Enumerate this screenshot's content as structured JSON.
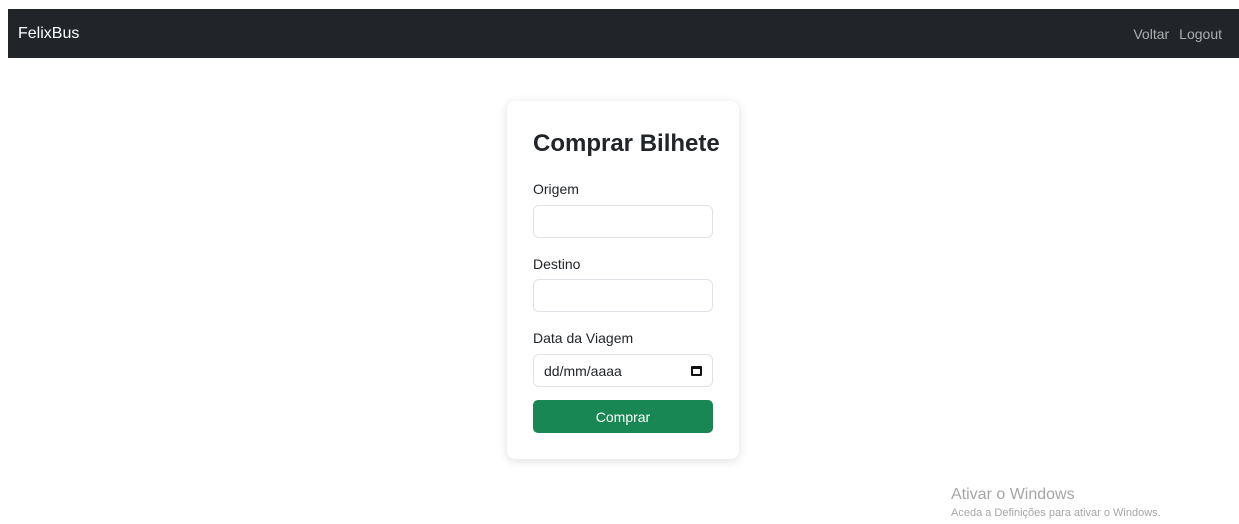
{
  "navbar": {
    "brand": "FelixBus",
    "links": [
      {
        "label": "Voltar"
      },
      {
        "label": "Logout"
      }
    ]
  },
  "form": {
    "title": "Comprar Bilhete",
    "origin": {
      "label": "Origem",
      "value": ""
    },
    "destination": {
      "label": "Destino",
      "value": ""
    },
    "date": {
      "label": "Data da Viagem",
      "placeholder": "dd/mm/aaaa",
      "icon": "calendar-icon"
    },
    "submit_label": "Comprar"
  },
  "colors": {
    "navbar_bg": "#212529",
    "button_bg": "#198754"
  },
  "watermark": {
    "title": "Ativar o Windows",
    "subtitle": "Aceda a Definições para ativar o Windows."
  }
}
